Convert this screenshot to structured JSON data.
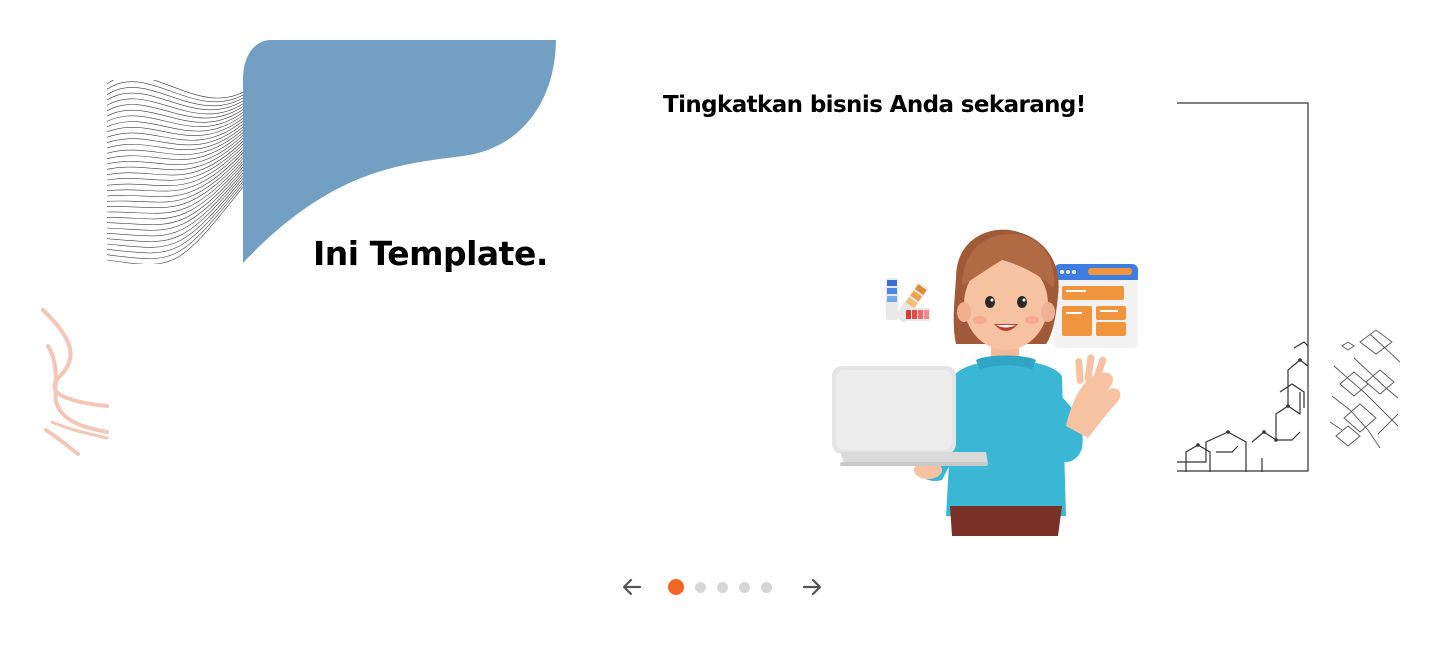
{
  "slides": [
    {
      "title": "Ini Template.",
      "accent_color": "#729fc2",
      "decoration_color": "#f3c6b5"
    },
    {
      "title": "Tingkatkan bisnis Anda sekarang!",
      "illustration": "person-with-laptop-illustration"
    }
  ],
  "carousel": {
    "prev_icon": "arrow-left-icon",
    "next_icon": "arrow-right-icon",
    "dot_count": 5,
    "active_index": 0,
    "active_color": "#f26522",
    "inactive_color": "#d6d6d6"
  }
}
